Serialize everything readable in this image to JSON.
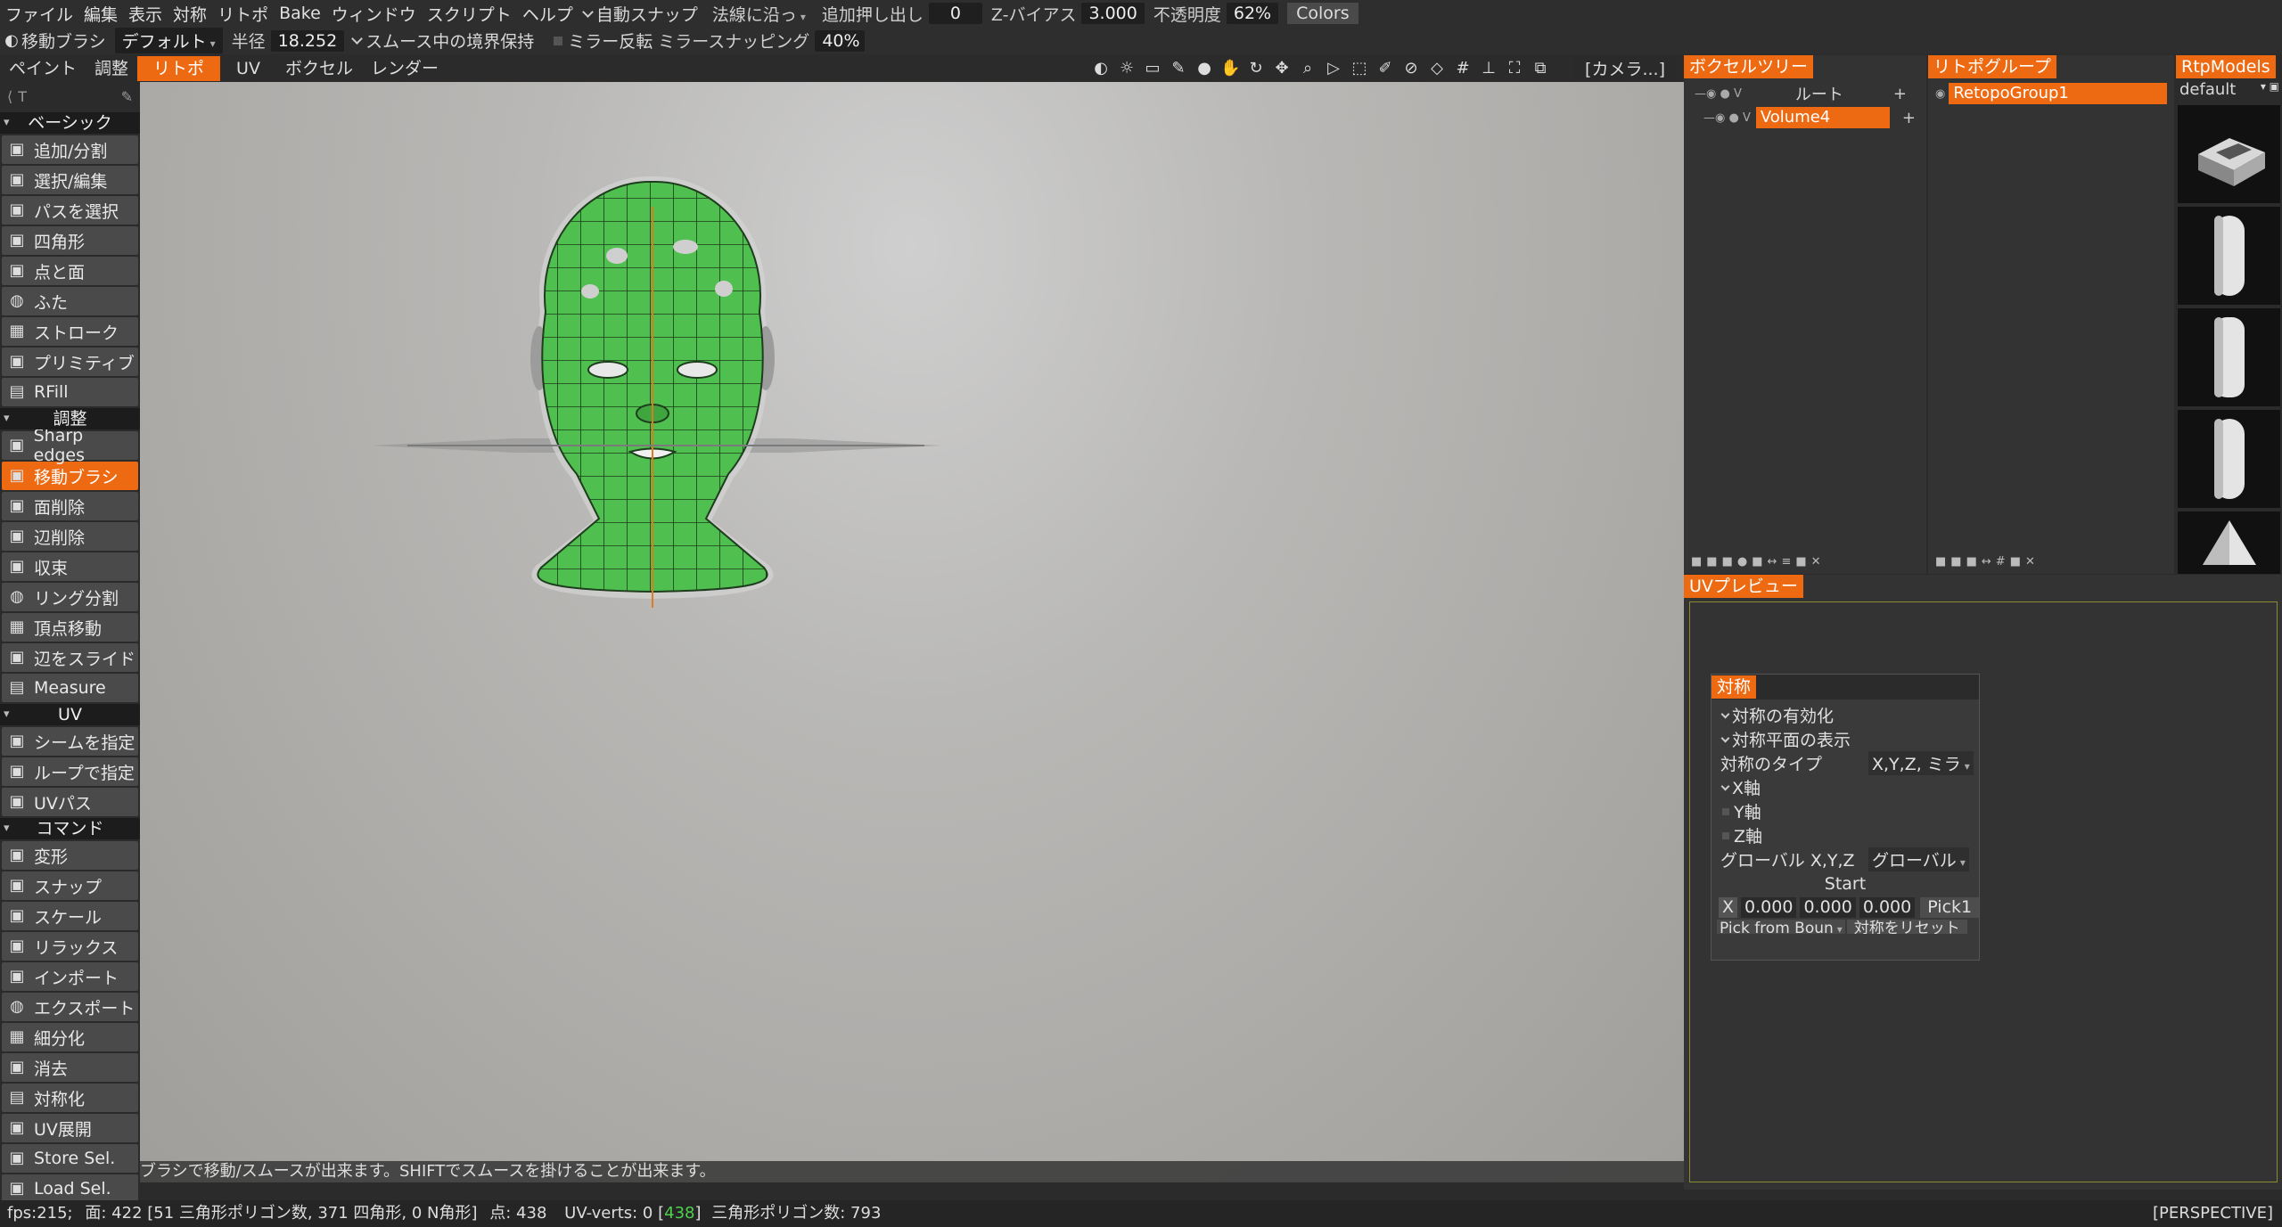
{
  "menu": [
    "ファイル",
    "編集",
    "表示",
    "対称",
    "リトポ",
    "Bake",
    "ウィンドウ",
    "スクリプト",
    "ヘルプ"
  ],
  "menu_opts": {
    "auto_snap": "自動スナップ",
    "along_normal": "法線に沿っ",
    "extrude_label": "追加押し出し",
    "extrude_value": "0",
    "zbias_label": "Z-バイアス",
    "zbias_value": "3.000",
    "opacity_label": "不透明度",
    "opacity_value": "62%",
    "colors": "Colors"
  },
  "tool_options": {
    "tool_name": "移動ブラシ",
    "preset": "デフォルト",
    "radius_label": "半径",
    "radius_value": "18.252",
    "smooth_boundary": "スムース中の境界保持",
    "mirror_flip": "ミラー反転",
    "mirror_snap_label": "ミラースナッピング",
    "mirror_snap_value": "40%"
  },
  "rooms": [
    "ペイント",
    "調整",
    "リトポ",
    "UV",
    "ボクセル",
    "レンダー"
  ],
  "active_room": "リトポ",
  "camera_label": "[カメラ...]",
  "left_panel": {
    "search_placeholder": "T",
    "sections": [
      {
        "title": "ベーシック",
        "items": [
          "追加/分割",
          "選択/編集",
          "パスを選択",
          "四角形",
          "点と面",
          "ふた",
          "ストローク",
          "プリミティブ",
          "RFill"
        ]
      },
      {
        "title": "調整",
        "items": [
          "Sharp edges",
          "移動ブラシ",
          "面削除",
          "辺削除",
          "収束",
          "リング分割",
          "頂点移動",
          "辺をスライド",
          "Measure"
        ]
      },
      {
        "title": "UV",
        "items": [
          "シームを指定",
          "ループで指定",
          "UVパス"
        ]
      },
      {
        "title": "コマンド",
        "items": [
          "変形",
          "スナップ",
          "スケール",
          "リラックス",
          "インポート",
          "エクスポート",
          "細分化",
          "消去",
          "対称化",
          "UV展開",
          "Store Sel.",
          "Load Sel."
        ]
      }
    ],
    "active_item": "移動ブラシ"
  },
  "viewport": {
    "hint": "ブラシで移動/スムースが出来ます。SHIFTでスムースを掛けることが出来ます。"
  },
  "voxel_tree": {
    "title": "ボクセルツリー",
    "root": "ルート",
    "volume": "Volume4"
  },
  "retopo_groups": {
    "title": "リトポグループ",
    "group": "RetopoGroup1"
  },
  "rtp_models": {
    "title": "RtpModels",
    "preset": "default"
  },
  "uv_preview": {
    "title": "UVプレビュー"
  },
  "symmetry": {
    "title": "対称",
    "enable": "対称の有効化",
    "show_plane": "対称平面の表示",
    "type_label": "対称のタイプ",
    "type_value": "X,Y,Z, ミラ",
    "x_axis": "X軸",
    "y_axis": "Y軸",
    "z_axis": "Z軸",
    "global_label": "グローバル X,Y,Z",
    "global_value": "グローバル",
    "start_label": "Start",
    "x_label": "X",
    "vals": [
      "0.000",
      "0.000",
      "0.000"
    ],
    "pick": "Pick1",
    "pick_from": "Pick from Boun",
    "reset": "対称をリセット"
  },
  "status": {
    "fps": "fps:215;",
    "faces": "面: 422 [51 三角形ポリゴン数, 371 四角形, 0 N角形]",
    "points": "点: 438",
    "uv_verts_label": "UV-verts: 0 [",
    "uv_verts_green": "438",
    "uv_verts_close": "]",
    "tri_count": "三角形ポリゴン数: 793",
    "mode": "[PERSPECTIVE]"
  },
  "colors": {
    "accent": "#ee6a12",
    "mesh_green": "#4fbf4f"
  }
}
